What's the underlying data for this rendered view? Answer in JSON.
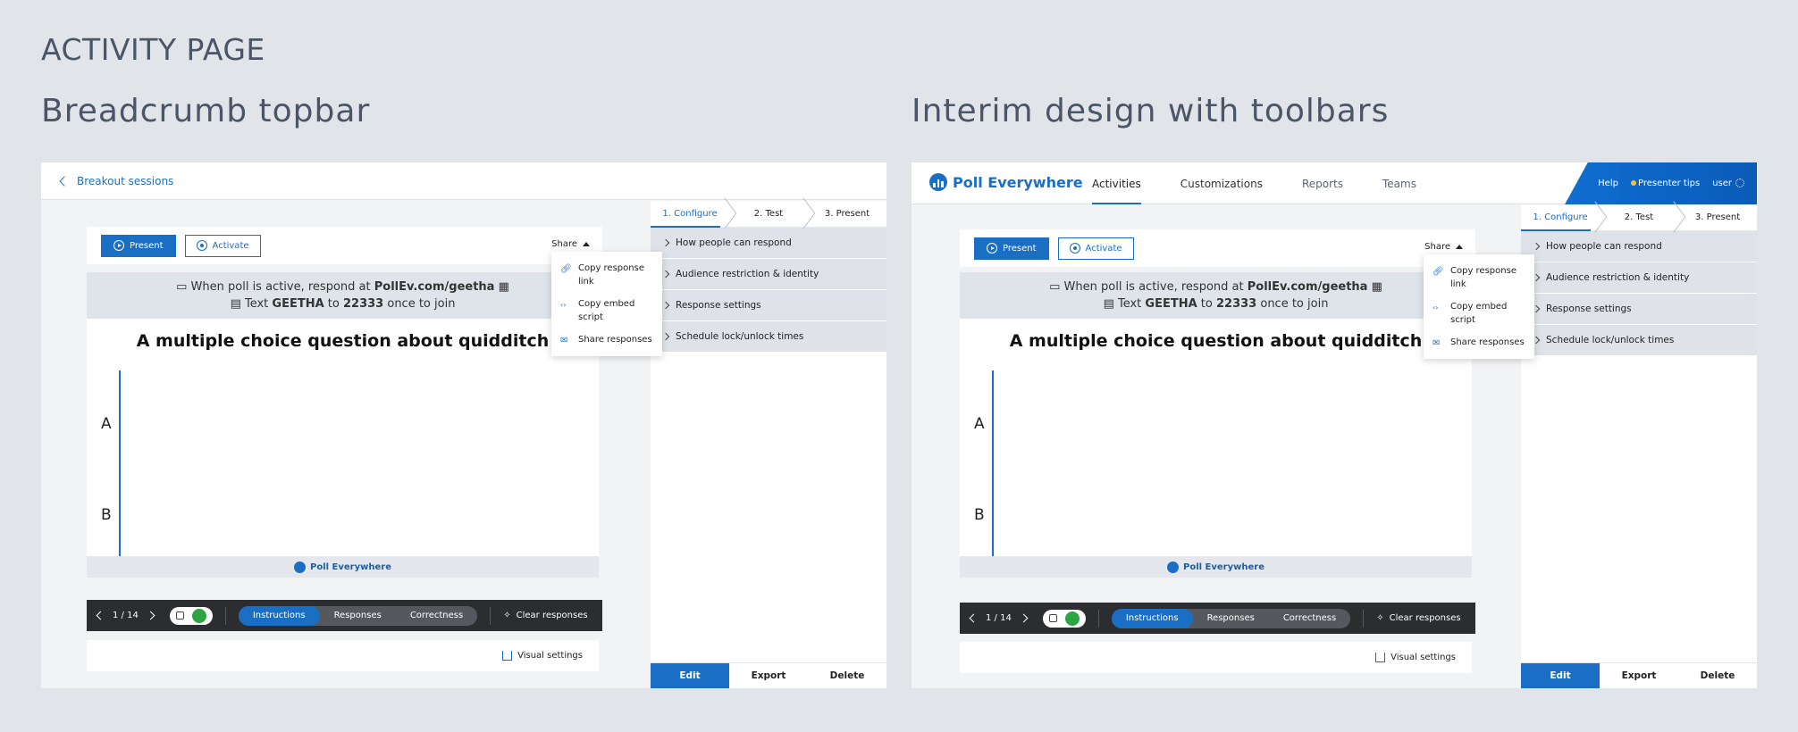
{
  "page_title": "ACTIVITY PAGE",
  "left": {
    "heading": "Breadcrumb topbar",
    "breadcrumb": "Breakout sessions"
  },
  "right": {
    "heading": "Interim design with toolbars",
    "brand": "Poll Everywhere",
    "nav": [
      "Activities",
      "Customizations",
      "Reports",
      "Teams"
    ],
    "help": "Help",
    "presenter_tips": "Presenter tips",
    "user": "user"
  },
  "toolbar": {
    "present": "Present",
    "activate": "Activate",
    "share": "Share"
  },
  "share_menu": {
    "copy_link": "Copy response link",
    "copy_embed": "Copy embed script",
    "share_responses": "Share responses"
  },
  "slide": {
    "respond_line_pre": "When poll is active, respond at ",
    "respond_url": "PollEv.com/geetha",
    "text_pre": "Text ",
    "text_code": "GEETHA",
    "text_to": " to ",
    "text_number": "22333",
    "text_post": " once to join",
    "question": "A multiple choice question about quidditch",
    "options": [
      "A",
      "B"
    ],
    "footer_brand": "Poll Everywhere"
  },
  "presenter_bar": {
    "page": "1 / 14",
    "tabs": [
      "Instructions",
      "Responses",
      "Correctness"
    ],
    "clear": "Clear responses"
  },
  "visual_settings": "Visual settings",
  "steps": [
    "1. Configure",
    "2. Test",
    "3. Present"
  ],
  "accordion": [
    "How people can respond",
    "Audience restriction & identity",
    "Response settings",
    "Schedule lock/unlock times"
  ],
  "actions": [
    "Edit",
    "Export",
    "Delete"
  ],
  "colors": {
    "accent": "#1a6fc4",
    "background": "#e1e5ea",
    "dark_toolbar": "#2c2d30",
    "lock_active": "#2aa541"
  }
}
